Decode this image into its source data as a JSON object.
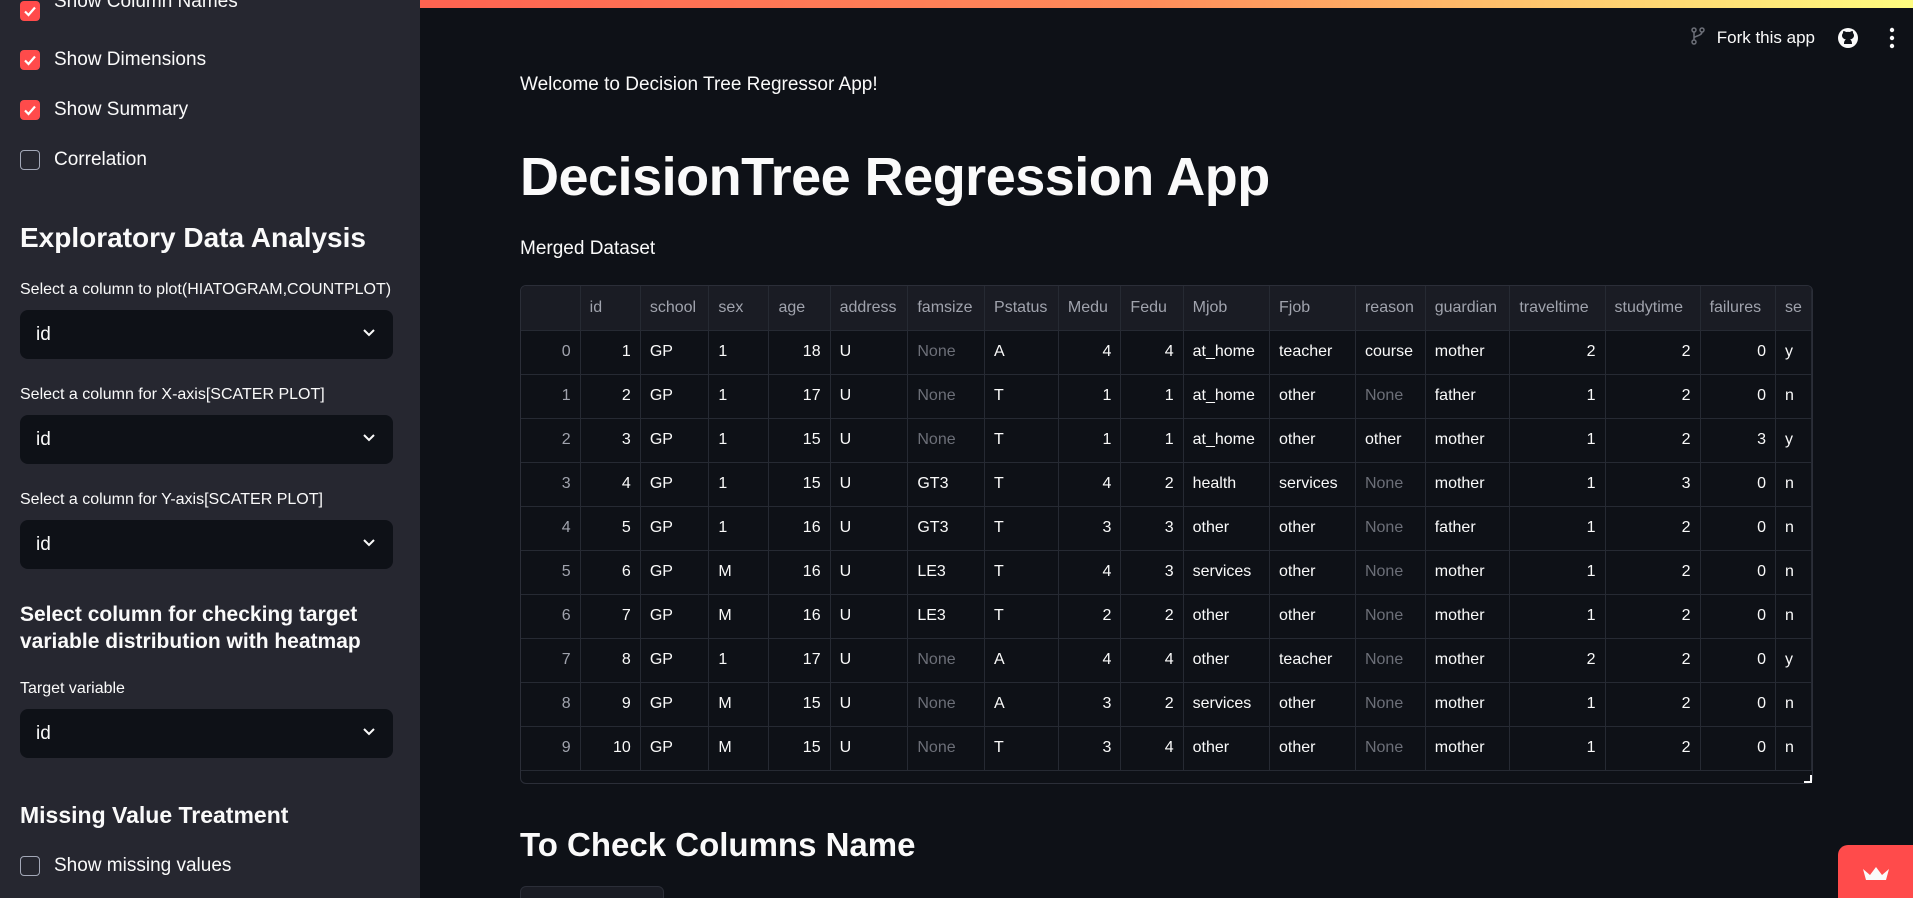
{
  "sidebar": {
    "checkboxes": [
      {
        "label": "Show Column Names",
        "checked": true
      },
      {
        "label": "Show Dimensions",
        "checked": true
      },
      {
        "label": "Show Summary",
        "checked": true
      },
      {
        "label": "Correlation",
        "checked": false
      }
    ],
    "eda_title": "Exploratory Data Analysis",
    "plot_label": "Select a column to plot(HIATOGRAM,COUNTPLOT)",
    "plot_value": "id",
    "x_label": "Select a column for X-axis[SCATER PLOT]",
    "x_value": "id",
    "y_label": "Select a column for Y-axis[SCATER PLOT]",
    "y_value": "id",
    "heatmap_title_1": "Select column for checking target",
    "heatmap_title_2": "variable distribution with heatmap",
    "target_label": "Target variable",
    "target_value": "id",
    "missing_title": "Missing Value Treatment",
    "missing_checkbox": {
      "label": "Show missing values",
      "checked": false
    }
  },
  "header": {
    "fork_label": "Fork this app"
  },
  "main": {
    "welcome": "Welcome to Decision Tree Regressor App!",
    "title": "DecisionTree Regression App",
    "subtitle": "Merged Dataset",
    "section2": "To Check Columns Name"
  },
  "table": {
    "columns": [
      "id",
      "school",
      "sex",
      "age",
      "address",
      "famsize",
      "Pstatus",
      "Medu",
      "Fedu",
      "Mjob",
      "Fjob",
      "reason",
      "guardian",
      "traveltime",
      "studytime",
      "failures",
      "se"
    ],
    "rows": [
      [
        "0",
        "1",
        "GP",
        "1",
        "18",
        "U",
        "None",
        "A",
        "4",
        "4",
        "at_home",
        "teacher",
        "course",
        "mother",
        "2",
        "2",
        "0",
        "y"
      ],
      [
        "1",
        "2",
        "GP",
        "1",
        "17",
        "U",
        "None",
        "T",
        "1",
        "1",
        "at_home",
        "other",
        "None",
        "father",
        "1",
        "2",
        "0",
        "n"
      ],
      [
        "2",
        "3",
        "GP",
        "1",
        "15",
        "U",
        "None",
        "T",
        "1",
        "1",
        "at_home",
        "other",
        "other",
        "mother",
        "1",
        "2",
        "3",
        "y"
      ],
      [
        "3",
        "4",
        "GP",
        "1",
        "15",
        "U",
        "GT3",
        "T",
        "4",
        "2",
        "health",
        "services",
        "None",
        "mother",
        "1",
        "3",
        "0",
        "n"
      ],
      [
        "4",
        "5",
        "GP",
        "1",
        "16",
        "U",
        "GT3",
        "T",
        "3",
        "3",
        "other",
        "other",
        "None",
        "father",
        "1",
        "2",
        "0",
        "n"
      ],
      [
        "5",
        "6",
        "GP",
        "M",
        "16",
        "U",
        "LE3",
        "T",
        "4",
        "3",
        "services",
        "other",
        "None",
        "mother",
        "1",
        "2",
        "0",
        "n"
      ],
      [
        "6",
        "7",
        "GP",
        "M",
        "16",
        "U",
        "LE3",
        "T",
        "2",
        "2",
        "other",
        "other",
        "None",
        "mother",
        "1",
        "2",
        "0",
        "n"
      ],
      [
        "7",
        "8",
        "GP",
        "1",
        "17",
        "U",
        "None",
        "A",
        "4",
        "4",
        "other",
        "teacher",
        "None",
        "mother",
        "2",
        "2",
        "0",
        "y"
      ],
      [
        "8",
        "9",
        "GP",
        "M",
        "15",
        "U",
        "None",
        "A",
        "3",
        "2",
        "services",
        "other",
        "None",
        "mother",
        "1",
        "2",
        "0",
        "n"
      ],
      [
        "9",
        "10",
        "GP",
        "M",
        "15",
        "U",
        "None",
        "T",
        "3",
        "4",
        "other",
        "other",
        "None",
        "mother",
        "1",
        "2",
        "0",
        "n"
      ]
    ]
  },
  "colors": {
    "accent": "#ff4b4b",
    "sidebar_bg": "#262730",
    "main_bg": "#0e1117"
  }
}
